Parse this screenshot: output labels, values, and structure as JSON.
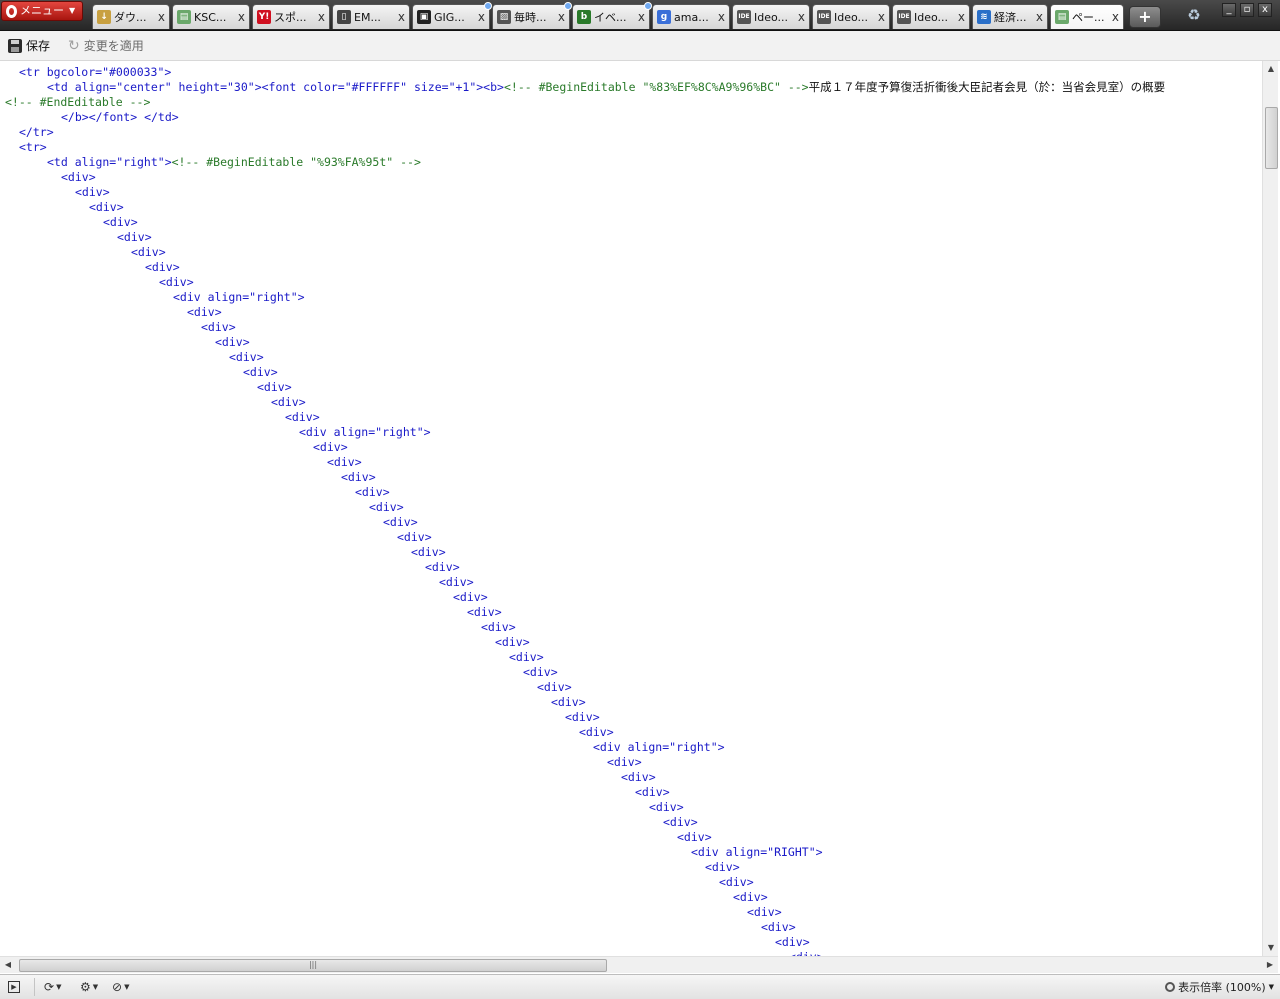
{
  "browser": {
    "menu_label": "メニュー",
    "tabs": [
      {
        "title": "ダウ...",
        "icon": "download-icon",
        "color": "#c8a040",
        "glyph": "↓"
      },
      {
        "title": "KSC...",
        "icon": "page-icon",
        "color": "#6aa86a",
        "glyph": "▤"
      },
      {
        "title": "スポ...",
        "icon": "yahoo-icon",
        "color": "#d01020",
        "glyph": "Y!"
      },
      {
        "title": "EM...",
        "icon": "book-icon",
        "color": "#444444",
        "glyph": "▯"
      },
      {
        "title": "GIG...",
        "icon": "gigazine-icon",
        "color": "#222222",
        "glyph": "▣"
      },
      {
        "title": "毎時...",
        "icon": "image-icon",
        "color": "#555555",
        "glyph": "▨"
      },
      {
        "title": "イベ...",
        "icon": "b-icon",
        "color": "#2a7a2a",
        "glyph": "b"
      },
      {
        "title": "ama...",
        "icon": "google-icon",
        "color": "#3a6fd8",
        "glyph": "g"
      },
      {
        "title": "Ideo...",
        "icon": "ideone-icon",
        "color": "#555555",
        "glyph": "IDE"
      },
      {
        "title": "Ideo...",
        "icon": "ideone-icon",
        "color": "#555555",
        "glyph": "IDE"
      },
      {
        "title": "Ideo...",
        "icon": "ideone-icon",
        "color": "#555555",
        "glyph": "IDE"
      },
      {
        "title": "経済...",
        "icon": "nikkei-icon",
        "color": "#2a6fc8",
        "glyph": "≋"
      },
      {
        "title": "ペー...",
        "icon": "page-source-icon",
        "color": "#6aa86a",
        "glyph": "▤"
      }
    ],
    "close_glyph": "x",
    "new_tab_glyph": "+",
    "window_controls": [
      "_",
      "▫",
      "x"
    ]
  },
  "toolbar": {
    "save_label": "保存",
    "apply_label": "変更を適用"
  },
  "source_lines": [
    [
      [
        "tag",
        "<tr bgcolor=\"#000033\">"
      ]
    ],
    [
      [
        "tag",
        "<td align=\"center\" height=\"30\"><font color=\"#FFFFFF\" size=\"+1\"><b>"
      ],
      [
        "cmt",
        "<!-- #BeginEditable \"%83%EF%8C%A9%96%BC\" -->"
      ],
      [
        "txt",
        "平成１７年度予算復活折衝後大臣記者会見（於：当省会見室）の概要"
      ]
    ],
    [
      [
        "cmt",
        "<!-- #EndEditable -->"
      ]
    ],
    [
      [
        "tag",
        "</b></font> </td>"
      ]
    ],
    [
      [
        "tag",
        "</tr>"
      ]
    ],
    [
      [
        "tag",
        "<tr>"
      ]
    ],
    [
      [
        "tag",
        "<td align=\"right\">"
      ],
      [
        "cmt",
        "<!-- #BeginEditable \"%93%FA%95t\" -->"
      ]
    ],
    [
      [
        "tag",
        "<div>"
      ]
    ],
    [
      [
        "tag",
        "<div>"
      ]
    ],
    [
      [
        "tag",
        "<div>"
      ]
    ],
    [
      [
        "tag",
        "<div>"
      ]
    ],
    [
      [
        "tag",
        "<div>"
      ]
    ],
    [
      [
        "tag",
        "<div>"
      ]
    ],
    [
      [
        "tag",
        "<div>"
      ]
    ],
    [
      [
        "tag",
        "<div>"
      ]
    ],
    [
      [
        "tag",
        "<div align=\"right\">"
      ]
    ],
    [
      [
        "tag",
        "<div>"
      ]
    ],
    [
      [
        "tag",
        "<div>"
      ]
    ],
    [
      [
        "tag",
        "<div>"
      ]
    ],
    [
      [
        "tag",
        "<div>"
      ]
    ],
    [
      [
        "tag",
        "<div>"
      ]
    ],
    [
      [
        "tag",
        "<div>"
      ]
    ],
    [
      [
        "tag",
        "<div>"
      ]
    ],
    [
      [
        "tag",
        "<div>"
      ]
    ],
    [
      [
        "tag",
        "<div align=\"right\">"
      ]
    ],
    [
      [
        "tag",
        "<div>"
      ]
    ],
    [
      [
        "tag",
        "<div>"
      ]
    ],
    [
      [
        "tag",
        "<div>"
      ]
    ],
    [
      [
        "tag",
        "<div>"
      ]
    ],
    [
      [
        "tag",
        "<div>"
      ]
    ],
    [
      [
        "tag",
        "<div>"
      ]
    ],
    [
      [
        "tag",
        "<div>"
      ]
    ],
    [
      [
        "tag",
        "<div>"
      ]
    ],
    [
      [
        "tag",
        "<div>"
      ]
    ],
    [
      [
        "tag",
        "<div>"
      ]
    ],
    [
      [
        "tag",
        "<div>"
      ]
    ],
    [
      [
        "tag",
        "<div>"
      ]
    ],
    [
      [
        "tag",
        "<div>"
      ]
    ],
    [
      [
        "tag",
        "<div>"
      ]
    ],
    [
      [
        "tag",
        "<div>"
      ]
    ],
    [
      [
        "tag",
        "<div>"
      ]
    ],
    [
      [
        "tag",
        "<div>"
      ]
    ],
    [
      [
        "tag",
        "<div>"
      ]
    ],
    [
      [
        "tag",
        "<div>"
      ]
    ],
    [
      [
        "tag",
        "<div>"
      ]
    ],
    [
      [
        "tag",
        "<div align=\"right\">"
      ]
    ],
    [
      [
        "tag",
        "<div>"
      ]
    ],
    [
      [
        "tag",
        "<div>"
      ]
    ],
    [
      [
        "tag",
        "<div>"
      ]
    ],
    [
      [
        "tag",
        "<div>"
      ]
    ],
    [
      [
        "tag",
        "<div>"
      ]
    ],
    [
      [
        "tag",
        "<div>"
      ]
    ],
    [
      [
        "tag",
        "<div align=\"RIGHT\">"
      ]
    ],
    [
      [
        "tag",
        "<div>"
      ]
    ],
    [
      [
        "tag",
        "<div>"
      ]
    ],
    [
      [
        "tag",
        "<div>"
      ]
    ],
    [
      [
        "tag",
        "<div>"
      ]
    ],
    [
      [
        "tag",
        "<div>"
      ]
    ],
    [
      [
        "tag",
        "<div>"
      ]
    ],
    [
      [
        "tag",
        "<div>"
      ]
    ]
  ],
  "statusbar": {
    "zoom_label": "表示倍率 (100%)"
  }
}
